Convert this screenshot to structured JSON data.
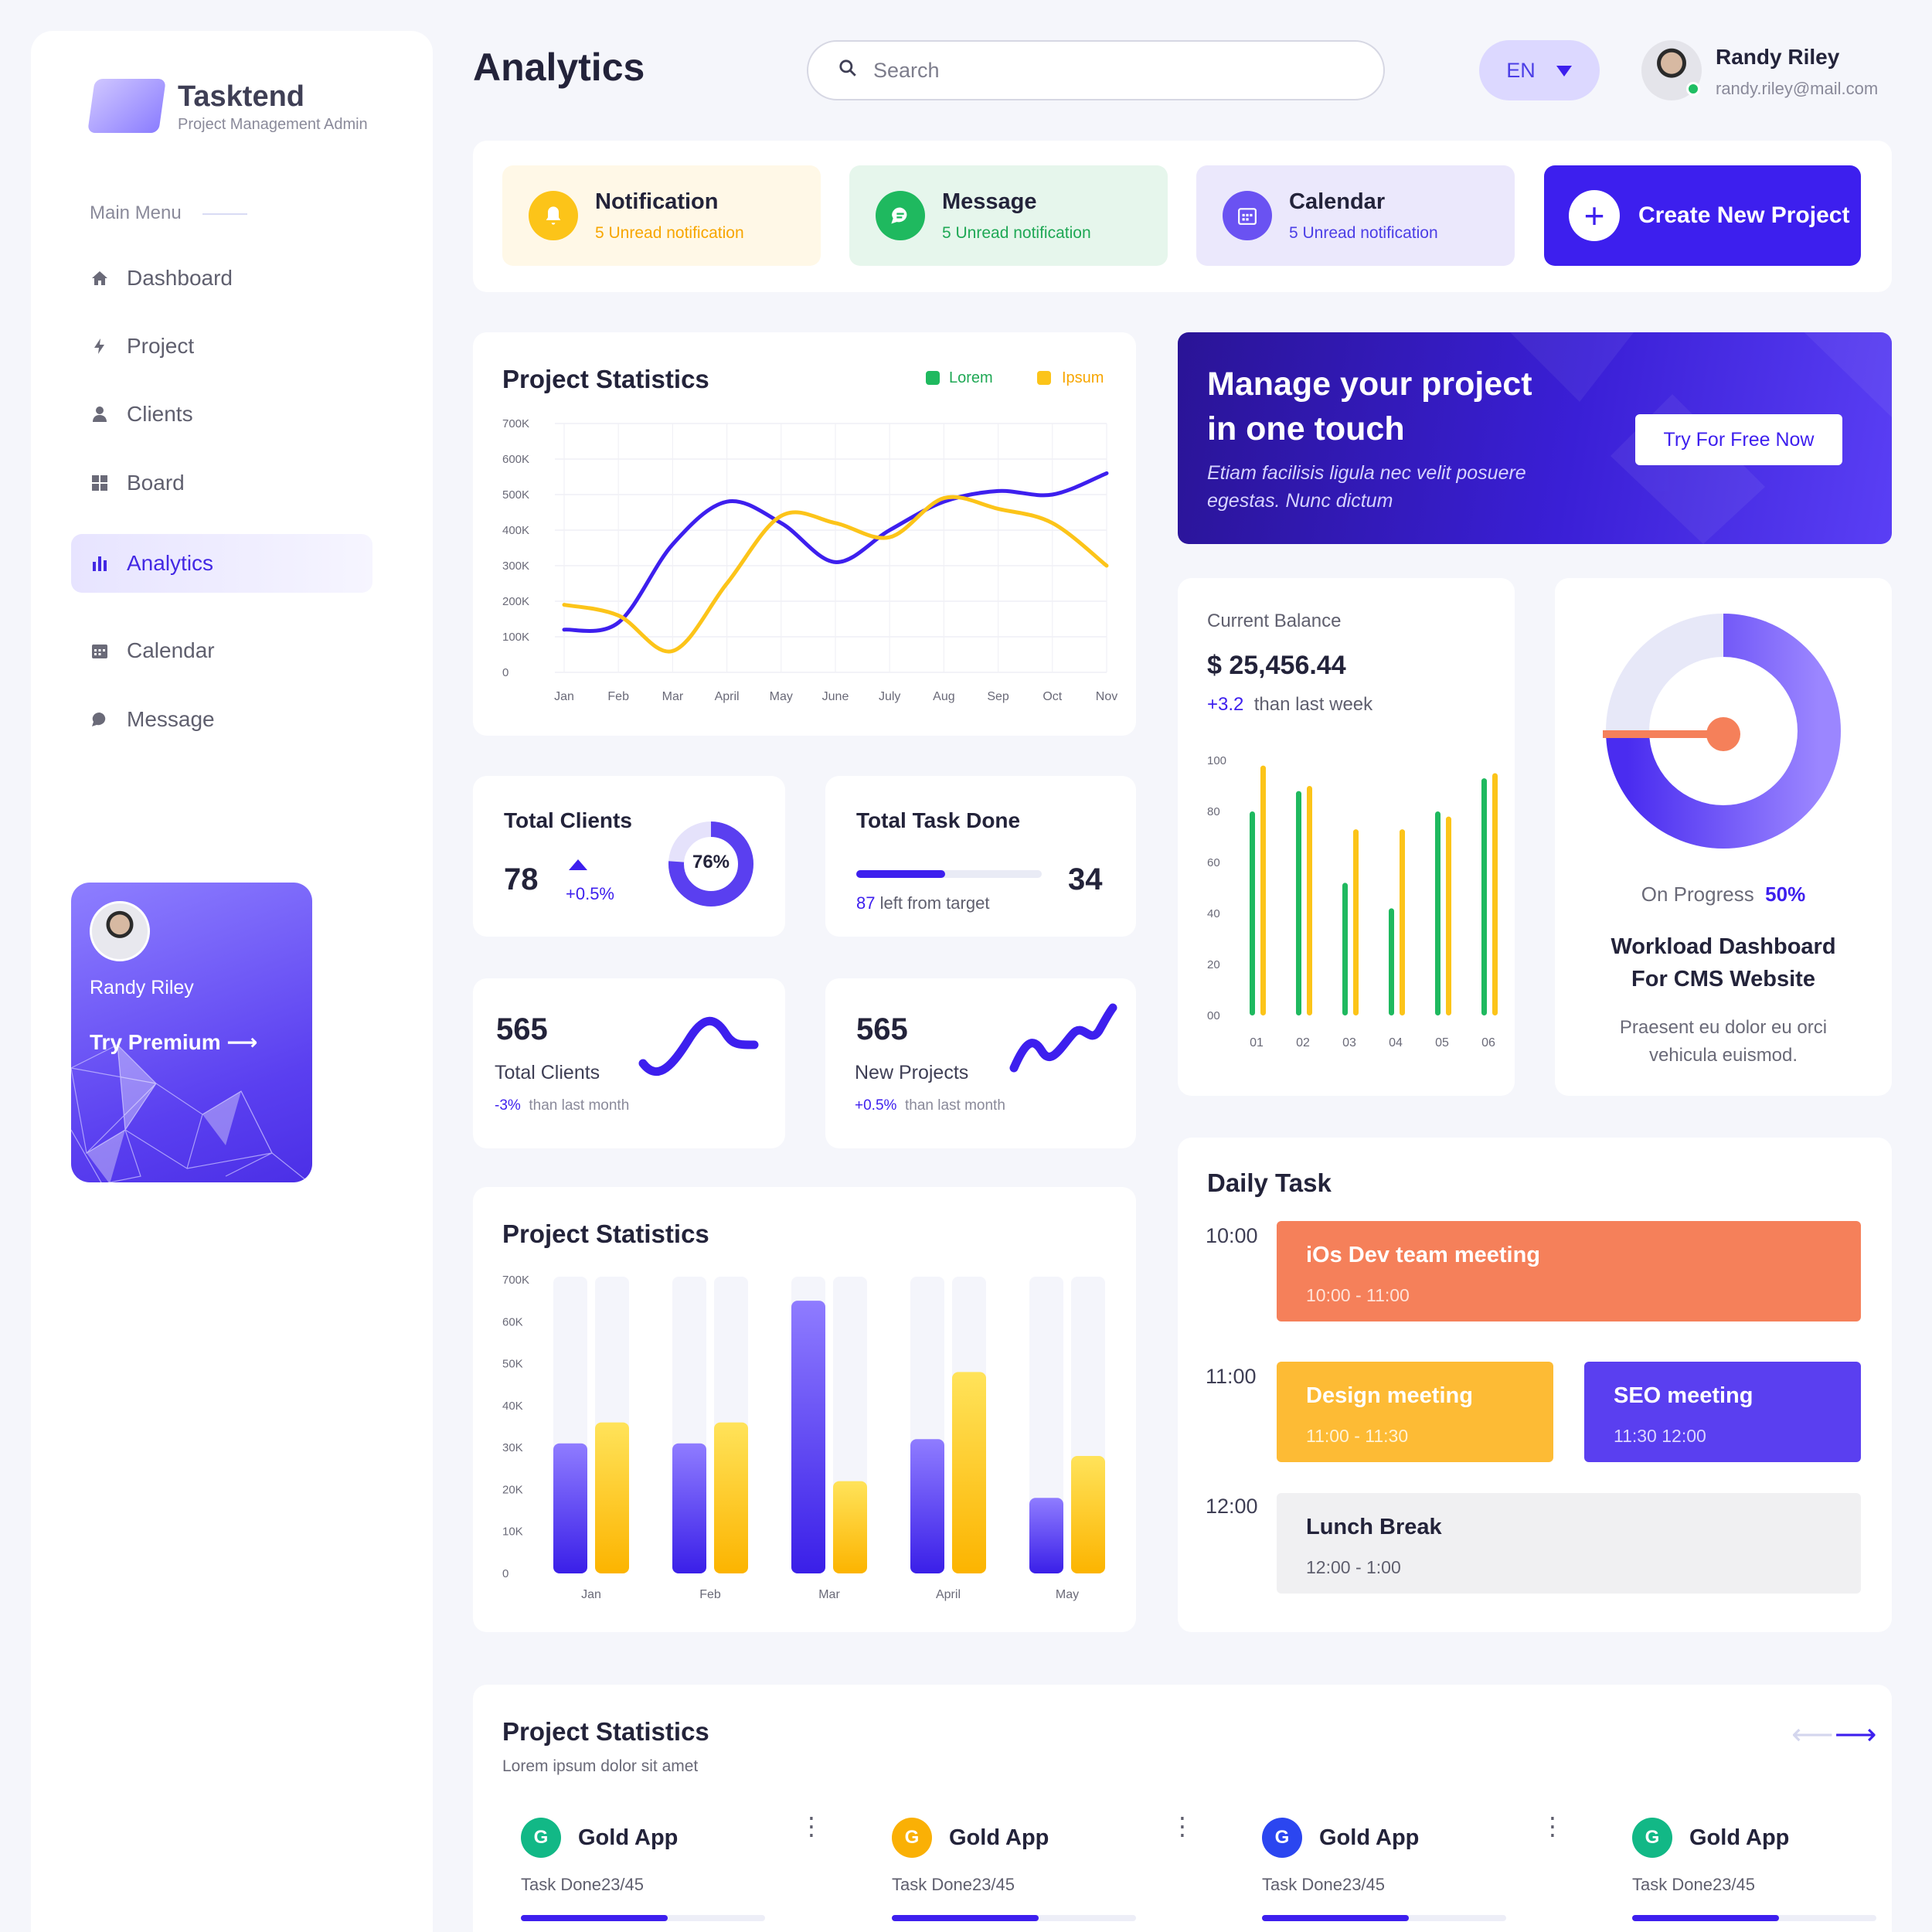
{
  "app": {
    "name": "Tasktend",
    "subtitle": "Project Management Admin"
  },
  "sidebar": {
    "menu_label": "Main Menu",
    "items": [
      {
        "label": "Dashboard",
        "icon": "home-icon"
      },
      {
        "label": "Project",
        "icon": "bolt-icon"
      },
      {
        "label": "Clients",
        "icon": "user-icon"
      },
      {
        "label": "Board",
        "icon": "grid-icon"
      },
      {
        "label": "Analytics",
        "icon": "bar-chart-icon",
        "active": true
      },
      {
        "label": "Calendar",
        "icon": "calendar-icon"
      },
      {
        "label": "Message",
        "icon": "chat-icon"
      }
    ],
    "premium": {
      "name": "Randy Riley",
      "cta": "Try Premium"
    }
  },
  "header": {
    "title": "Analytics",
    "search_placeholder": "Search",
    "language": "EN",
    "user": {
      "name": "Randy Riley",
      "email": "randy.riley@mail.com"
    }
  },
  "notifications": [
    {
      "title": "Notification",
      "subtitle": "5 Unread notification",
      "icon": "bell-icon",
      "color": "#f7b500",
      "bg": "#fff8e7"
    },
    {
      "title": "Message",
      "subtitle": "5 Unread notification",
      "icon": "chat-icon",
      "color": "#1fb95f",
      "bg": "#e6f6ec"
    },
    {
      "title": "Calendar",
      "subtitle": "5 Unread notification",
      "icon": "calendar-icon",
      "color": "#5a3ff0",
      "bg": "#ebe8fc"
    }
  ],
  "create_button": "Create New Project",
  "line_chart": {
    "title": "Project Statistics",
    "legend": [
      "Lorem",
      "Ipsum"
    ],
    "y_ticks": [
      "700K",
      "600K",
      "500K",
      "400K",
      "300K",
      "200K",
      "100K",
      "0"
    ],
    "x_ticks": [
      "Jan",
      "Feb",
      "Mar",
      "April",
      "May",
      "June",
      "July",
      "Aug",
      "Sep",
      "Oct",
      "Nov"
    ]
  },
  "chart_data": [
    {
      "type": "line",
      "title": "Project Statistics",
      "x": [
        "Jan",
        "Feb",
        "Mar",
        "April",
        "May",
        "June",
        "July",
        "Aug",
        "Sep",
        "Oct",
        "Nov"
      ],
      "ylim": [
        0,
        700000
      ],
      "series": [
        {
          "name": "Lorem",
          "color": "#3d1fee",
          "values": [
            120000,
            140000,
            360000,
            480000,
            420000,
            310000,
            400000,
            480000,
            510000,
            500000,
            560000
          ]
        },
        {
          "name": "Ipsum",
          "color": "#fcc419",
          "values": [
            190000,
            160000,
            60000,
            250000,
            440000,
            420000,
            380000,
            490000,
            460000,
            420000,
            300000
          ]
        }
      ],
      "legend_position": "top-right",
      "grid": true
    },
    {
      "type": "bar",
      "title": "",
      "categories": [
        "01",
        "02",
        "03",
        "04",
        "05",
        "06"
      ],
      "y_ticks": [
        "100",
        "80",
        "60",
        "40",
        "20",
        "00"
      ],
      "ylim": [
        0,
        100
      ],
      "series": [
        {
          "color": "#1fb95f",
          "values": [
            80,
            88,
            52,
            42,
            80,
            93
          ]
        },
        {
          "color": "#fcc419",
          "values": [
            98,
            90,
            73,
            73,
            78,
            95
          ]
        }
      ]
    },
    {
      "type": "bar",
      "title": "Project Statistics",
      "categories": [
        "Jan",
        "Feb",
        "Mar",
        "April",
        "May"
      ],
      "y_ticks": [
        "700K",
        "60K",
        "50K",
        "40K",
        "30K",
        "20K",
        "10K",
        "0"
      ],
      "series": [
        {
          "color": "#5a3ff0",
          "values": [
            31000,
            31000,
            65000,
            32000,
            18000
          ]
        },
        {
          "color": "#fcc419",
          "values": [
            36000,
            36000,
            22000,
            48000,
            28000
          ]
        }
      ]
    }
  ],
  "promo": {
    "title_line1": "Manage your project",
    "title_line2": "in one touch",
    "text": "Etiam facilisis ligula nec velit posuere egestas. Nunc dictum",
    "button": "Try For Free Now"
  },
  "total_clients": {
    "title": "Total Clients",
    "value": "78",
    "change": "+0.5%",
    "percent": "76%",
    "percent_value": 76
  },
  "total_task": {
    "title": "Total Task Done",
    "value": "34",
    "left_num": "87",
    "left_text": "left from target",
    "progress": 0.48
  },
  "stat_clients": {
    "value": "565",
    "label": "Total Clients",
    "change": "-3%",
    "suffix": "than last month"
  },
  "stat_projects": {
    "value": "565",
    "label": "New Projects",
    "change": "+0.5%",
    "suffix": "than last month"
  },
  "balance": {
    "label": "Current Balance",
    "value": "$ 25,456.44",
    "change": "+3.2",
    "suffix": "than last week"
  },
  "progress_card": {
    "label": "On Progress",
    "percent": "50%",
    "percent_value": 50,
    "title_line1": "Workload Dashboard",
    "title_line2": "For CMS Website",
    "text": "Praesent eu dolor eu orci vehicula euismod."
  },
  "daily": {
    "title": "Daily Task",
    "times": [
      "10:00",
      "11:00",
      "12:00"
    ],
    "tasks": [
      {
        "name": "iOs Dev team meeting",
        "time": "10:00 - 11:00",
        "color": "#f5805a"
      },
      {
        "name": "Design meeting",
        "time": "11:00 - 11:30",
        "color": "#fdbb35"
      },
      {
        "name": "SEO meeting",
        "time": "11:30 12:00",
        "color": "#5a3ff0"
      },
      {
        "name": "Lunch Break",
        "time": "12:00 - 1:00",
        "color": "#f0f0f2"
      }
    ]
  },
  "bar_chart_title": "Project Statistics",
  "projects": {
    "title": "Project Statistics",
    "subtitle": "Lorem ipsum dolor sit amet",
    "cards": [
      {
        "letter": "G",
        "name": "Gold App",
        "task": "Task Done",
        "count": "23/45",
        "color": "#12b886",
        "progress": 0.6
      },
      {
        "letter": "G",
        "name": "Gold App",
        "task": "Task Done",
        "count": "23/45",
        "color": "#fab005",
        "progress": 0.6
      },
      {
        "letter": "G",
        "name": "Gold App",
        "task": "Task Done",
        "count": "23/45",
        "color": "#2b46f0",
        "progress": 0.6
      },
      {
        "letter": "G",
        "name": "Gold App",
        "task": "Task Done",
        "count": "23/45",
        "color": "#12b886",
        "progress": 0.6
      }
    ]
  }
}
